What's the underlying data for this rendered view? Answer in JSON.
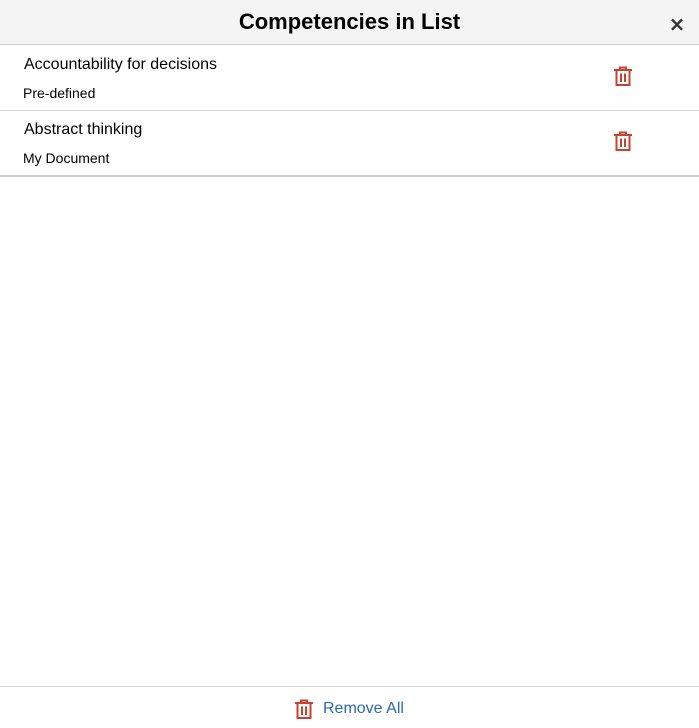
{
  "dialog": {
    "title": "Competencies in List",
    "close_label": "×"
  },
  "items": [
    {
      "name": "Accountability for decisions",
      "source": "Pre-defined"
    },
    {
      "name": "Abstract thinking",
      "source": "My Document"
    }
  ],
  "footer": {
    "remove_all_label": "Remove All"
  },
  "colors": {
    "trash_icon": "#c9412f",
    "link": "#2b6ab0",
    "header_bg": "#f4f4f4"
  },
  "icons": {
    "delete": "trash-icon",
    "close": "close-icon"
  }
}
